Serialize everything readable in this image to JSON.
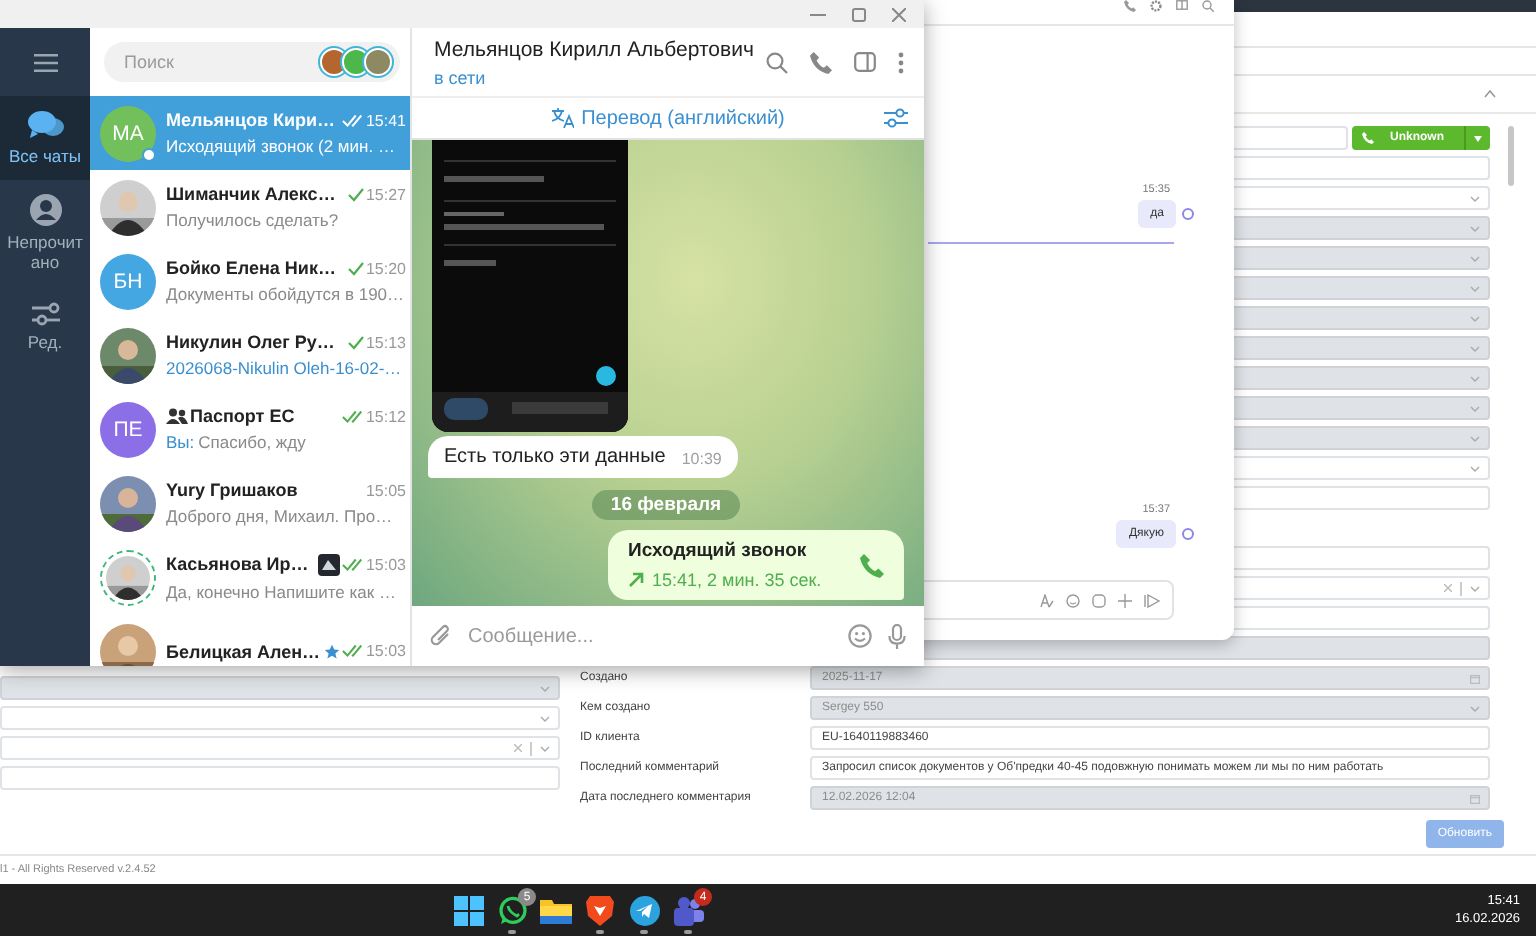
{
  "telegram": {
    "sidebar": [
      {
        "kind": "chats",
        "label": "Все чаты",
        "selected": true
      },
      {
        "kind": "person",
        "label": "Непрочитано",
        "selected": false
      },
      {
        "kind": "sliders",
        "label": "Ред.",
        "selected": false
      }
    ],
    "search": {
      "placeholder": "Поиск"
    },
    "stories": [
      {
        "color": "#b5652e"
      },
      {
        "color": "#4cb84c"
      },
      {
        "color": "#8d8a63"
      }
    ],
    "chats": [
      {
        "avatar": {
          "kind": "initials",
          "text": "МА",
          "color": "#72c05c"
        },
        "name": "Мельянцов Кири…",
        "group": false,
        "starred": false,
        "emoji_status": false,
        "time": "15:41",
        "delivered": true,
        "read": true,
        "preview": {
          "kind": "text",
          "text": "Исходящий звонок (2 мин. …"
        },
        "selected": true,
        "online": true,
        "story": false
      },
      {
        "name": "Шиманчик Алекс…",
        "group": false,
        "starred": false,
        "emoji_status": false,
        "time": "15:27",
        "delivered": true,
        "read": false,
        "preview": {
          "kind": "text",
          "text": "Получилось сделать?"
        },
        "selected": false,
        "online": false,
        "story": false
      },
      {
        "avatar": {
          "kind": "initials",
          "text": "БН",
          "color": "#44a7e2"
        },
        "name": "Бойко Елена Ник…",
        "group": false,
        "starred": false,
        "emoji_status": false,
        "time": "15:20",
        "delivered": true,
        "read": false,
        "preview": {
          "kind": "text",
          "text": "Документы обойдутся в 190…"
        },
        "selected": false,
        "online": false,
        "story": false
      },
      {
        "name": "Никулин Олег Ру…",
        "group": false,
        "starred": false,
        "emoji_status": false,
        "time": "15:13",
        "delivered": true,
        "read": false,
        "preview": {
          "kind": "file",
          "text": "2026068-Nikulin Oleh-16-02-…"
        },
        "selected": false,
        "online": false,
        "story": false
      },
      {
        "avatar": {
          "kind": "initials",
          "text": "ПЕ",
          "color": "#8c6ee6"
        },
        "name": "Паспорт ЕС",
        "group": true,
        "starred": false,
        "emoji_status": false,
        "time": "15:12",
        "delivered": true,
        "read": true,
        "preview": {
          "kind": "text",
          "sender": "Вы:",
          "text": "Спасибо, жду"
        },
        "selected": false,
        "online": false,
        "story": false
      },
      {
        "name": "Yury Гришаков",
        "group": false,
        "starred": false,
        "emoji_status": false,
        "time": "15:05",
        "delivered": false,
        "read": false,
        "preview": {
          "kind": "text",
          "text": "Доброго дня, Михаил. Про…"
        },
        "selected": false,
        "online": false,
        "story": false
      },
      {
        "name": "Касьянова Ир…",
        "group": false,
        "starred": false,
        "emoji_status": true,
        "time": "15:03",
        "delivered": true,
        "read": true,
        "preview": {
          "kind": "text",
          "text": "Да, конечно Напишите как …"
        },
        "selected": false,
        "online": false,
        "story": true
      },
      {
        "name": "Белицкая Ален…",
        "group": false,
        "starred": true,
        "emoji_status": false,
        "time": "15:03",
        "delivered": true,
        "read": true,
        "selected": false,
        "online": false,
        "story": false
      }
    ],
    "chat": {
      "title": "Мельянцов Кирилл Альбертович",
      "status": "в сети",
      "translate": "Перевод (английский)",
      "messages": [
        {
          "kind": "screenshot"
        },
        {
          "kind": "text",
          "text": "Есть только эти данные",
          "time": "10:39"
        },
        {
          "kind": "date",
          "text": "16 февраля"
        },
        {
          "kind": "call",
          "title": "Исходящий звонок",
          "detail": "15:41, 2 мин. 35 сек."
        }
      ],
      "input": {
        "placeholder": "Сообщение..."
      }
    }
  },
  "widget": {
    "messages": [
      {
        "time": "15:35",
        "text": "да"
      },
      {
        "time": "15:37",
        "text": "Дякую"
      }
    ]
  },
  "crm": {
    "call_button": "Unknown",
    "fields": [
      {
        "kind": "call",
        "disabled": false
      },
      {
        "kind": "input",
        "disabled": false
      },
      {
        "kind": "dropdown",
        "disabled": false
      },
      {
        "kind": "dropdown",
        "disabled": true
      },
      {
        "kind": "dropdown",
        "disabled": true
      },
      {
        "kind": "dropdown",
        "disabled": true
      },
      {
        "kind": "dropdown",
        "disabled": true
      },
      {
        "kind": "dropdown",
        "disabled": true
      },
      {
        "kind": "dropdown",
        "disabled": true
      },
      {
        "kind": "dropdown",
        "disabled": true
      },
      {
        "kind": "dropdown",
        "disabled": true
      },
      {
        "kind": "dropdown",
        "disabled": false
      },
      {
        "kind": "input",
        "disabled": false
      },
      {
        "kind": "gap"
      },
      {
        "kind": "input",
        "disabled": false
      },
      {
        "kind": "clearable",
        "disabled": false
      },
      {
        "kind": "input",
        "disabled": false
      },
      {
        "kind": "input",
        "disabled": true
      },
      {
        "kind": "date",
        "disabled": true,
        "label": "Создано",
        "value": "2025-11-17"
      },
      {
        "kind": "dropdown",
        "disabled": true,
        "label": "Кем создано",
        "value": "Sergey 550"
      },
      {
        "kind": "input",
        "disabled": false,
        "label": "ID клиента",
        "value": "EU-1640119883460"
      },
      {
        "kind": "input",
        "disabled": false,
        "label": "Последний комментарий",
        "value": "Запросил список документов у Об'предки 40-45 подовжную понимать можем ли мы по ним работать"
      },
      {
        "kind": "date",
        "disabled": true,
        "label": "Дата последнего комментария",
        "value": "12.02.2026 12:04"
      }
    ],
    "left_fields": [
      {
        "kind": "dropdown",
        "disabled": true
      },
      {
        "kind": "dropdown",
        "disabled": false
      },
      {
        "kind": "clearable",
        "disabled": false
      },
      {
        "kind": "input",
        "disabled": false
      }
    ],
    "update_button": "Обновить",
    "footer": "l1 - All Rights Reserved v.2.4.52"
  },
  "taskbar": {
    "apps": [
      {
        "kind": "start",
        "running": false
      },
      {
        "kind": "whatsapp",
        "running": true,
        "badge": "5",
        "color": "#8a8a8a"
      },
      {
        "kind": "folder",
        "running": false
      },
      {
        "kind": "brave",
        "running": true
      },
      {
        "kind": "telegram",
        "running": true
      },
      {
        "kind": "teams",
        "running": true,
        "badge": "4",
        "color": "#c42b1c"
      }
    ],
    "time": "15:41",
    "date": "16.02.2026"
  }
}
